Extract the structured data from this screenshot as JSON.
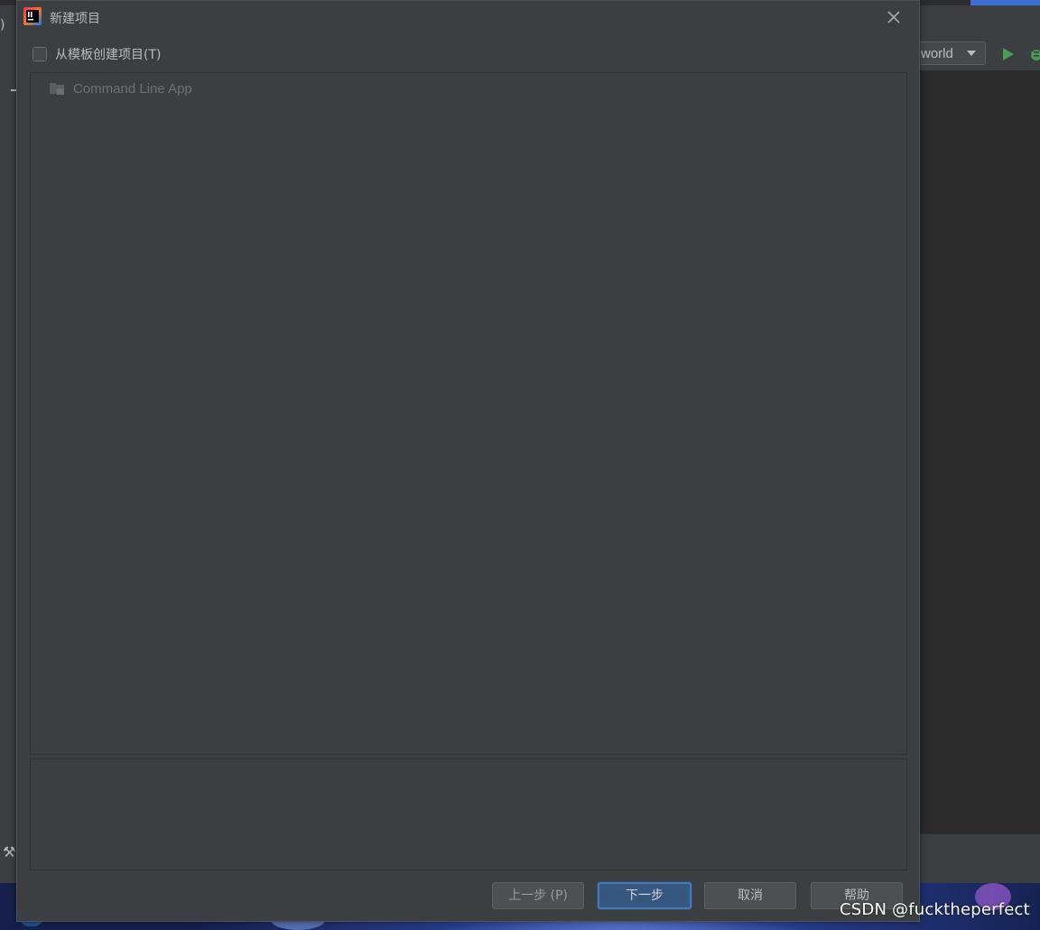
{
  "background_ide": {
    "left_clip_text": ")",
    "run_config_label": "world"
  },
  "dialog": {
    "title": "新建项目",
    "template_checkbox_label": "从模板创建项目(T)",
    "template_checkbox_checked": false,
    "templates": [
      {
        "label": "Command Line App",
        "icon": "folder-icon"
      }
    ],
    "description": "",
    "buttons": {
      "prev": "上一步 (P)",
      "next": "下一步",
      "cancel": "取消",
      "help": "帮助"
    }
  },
  "watermark": "CSDN @fucktheperfect",
  "colors": {
    "dialog_bg": "#3c3f41",
    "primary_button": "#365880",
    "run_green": "#499c54"
  }
}
